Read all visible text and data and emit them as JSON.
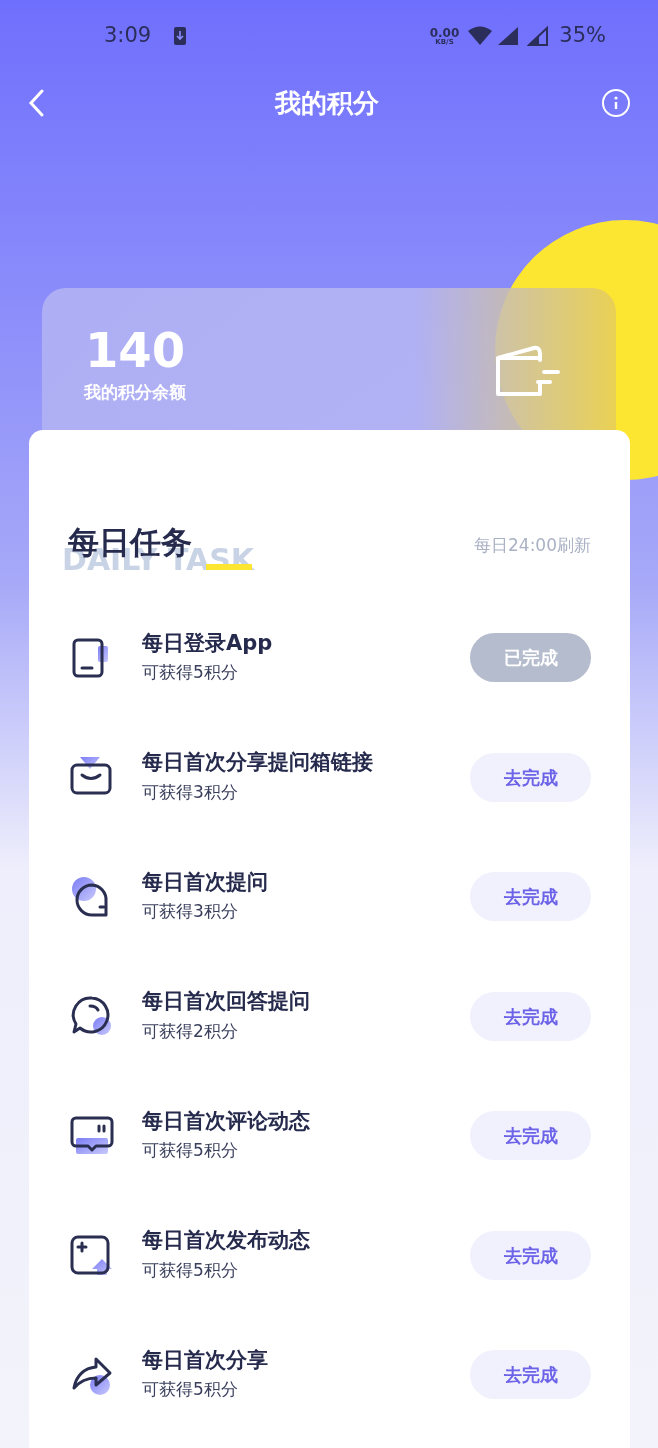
{
  "status_bar": {
    "time": "3:09",
    "net_speed": "0.00",
    "net_unit": "KB/S",
    "battery": "35%"
  },
  "header": {
    "title": "我的积分"
  },
  "balance": {
    "value": "140",
    "label": "我的积分余额"
  },
  "daily_tasks": {
    "title": "每日任务",
    "subtitle": "DAILY TASK",
    "refresh_note": "每日24:00刷新",
    "tasks": [
      {
        "kind": "tablet",
        "title": "每日登录App",
        "reward": "可获得5积分",
        "button": "已完成",
        "completed": true
      },
      {
        "kind": "mail",
        "title": "每日首次分享提问箱链接",
        "reward": "可获得3积分",
        "button": "去完成",
        "completed": false
      },
      {
        "kind": "bubble",
        "title": "每日首次提问",
        "reward": "可获得3积分",
        "button": "去完成",
        "completed": false
      },
      {
        "kind": "chat",
        "title": "每日首次回答提问",
        "reward": "可获得2积分",
        "button": "去完成",
        "completed": false
      },
      {
        "kind": "comment",
        "title": "每日首次评论动态",
        "reward": "可获得5积分",
        "button": "去完成",
        "completed": false
      },
      {
        "kind": "post",
        "title": "每日首次发布动态",
        "reward": "可获得5积分",
        "button": "去完成",
        "completed": false
      },
      {
        "kind": "share",
        "title": "每日首次分享",
        "reward": "可获得5积分",
        "button": "去完成",
        "completed": false
      }
    ]
  }
}
